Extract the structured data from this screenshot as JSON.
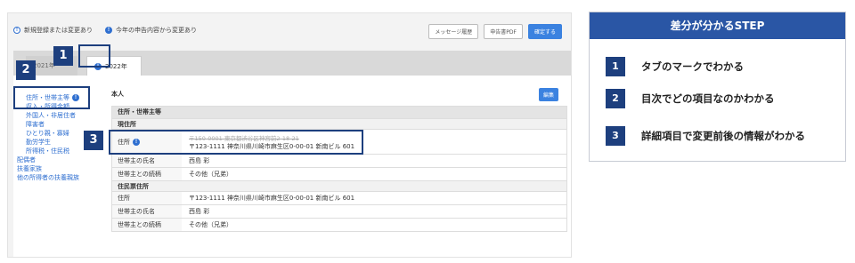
{
  "legend": {
    "new_or_changed": "新規登録または変更あり",
    "changed_from_last_year": "今年の申告内容から変更あり"
  },
  "toolbar": {
    "message_history": "メッセージ履歴",
    "print_pdf": "申告書PDF",
    "confirm": "確定する"
  },
  "tabs": [
    {
      "label": "2021年"
    },
    {
      "label": "2022年"
    }
  ],
  "sidebar": {
    "items": [
      {
        "label": "住所・世帯主等"
      },
      {
        "label": "収入・所得金額"
      },
      {
        "label": "外国人・非居住者"
      },
      {
        "label": "障害者"
      },
      {
        "label": "ひとり親・寡婦"
      },
      {
        "label": "勤労学生"
      },
      {
        "label": "所得税・住民税"
      },
      {
        "label": "配偶者"
      },
      {
        "label": "扶養家族"
      },
      {
        "label": "他の所得者の扶養親族"
      }
    ]
  },
  "main": {
    "title": "本人",
    "edit": "編集",
    "section": "住所・世帯主等",
    "current_address_heading": "現住所",
    "resident_address_heading": "住民票住所",
    "rows_current": {
      "address_label": "住所",
      "address_old": "〒150-0001 東京都渋谷区神宮前2-18-21",
      "address_new": "〒123-1111 神奈川県川崎市麻生区0-00-01 新南ビル 601",
      "householder_label": "世帯主の氏名",
      "householder_value": "西島 彩",
      "relation_label": "世帯主との続柄",
      "relation_value": "その他（兄弟）"
    },
    "rows_resident": {
      "address_label": "住所",
      "address_value": "〒123-1111 神奈川県川崎市麻生区0-00-01 新南ビル 601",
      "householder_label": "世帯主の氏名",
      "householder_value": "西島 彩",
      "relation_label": "世帯主との続柄",
      "relation_value": "その他（兄弟）"
    }
  },
  "markers": [
    "1",
    "2",
    "3"
  ],
  "steps": {
    "title": "差分が分かるSTEP",
    "items": [
      {
        "num": "1",
        "text": "タブのマークでわかる"
      },
      {
        "num": "2",
        "text": "目次でどの項目なのかわかる"
      },
      {
        "num": "3",
        "text": "詳細項目で変更前後の情報がわかる"
      }
    ]
  },
  "colors": {
    "accent": "#2f6fd0",
    "marker": "#1d3f7e",
    "header": "#2a56a5"
  }
}
